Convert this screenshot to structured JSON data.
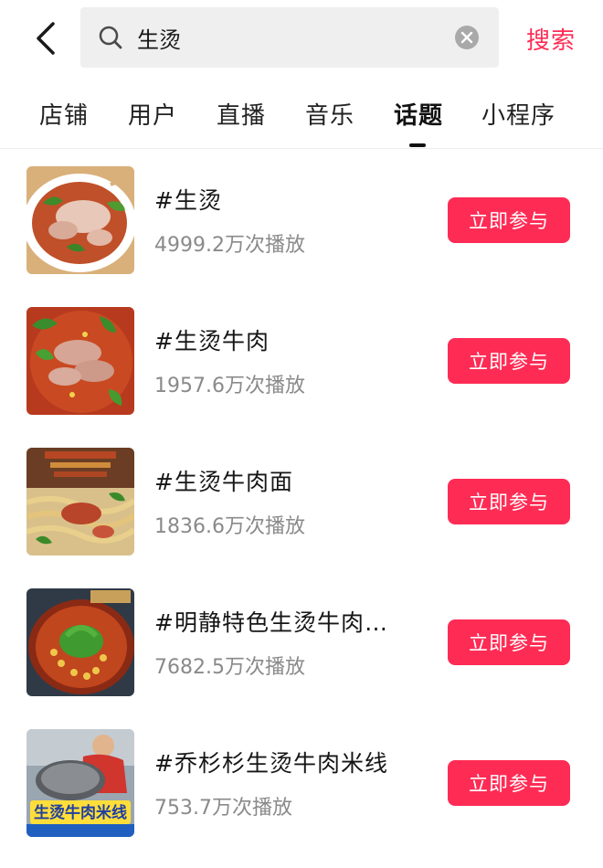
{
  "search": {
    "query": "生烫",
    "button_label": "搜索"
  },
  "tabs": [
    {
      "label": "店铺"
    },
    {
      "label": "用户"
    },
    {
      "label": "直播"
    },
    {
      "label": "音乐"
    },
    {
      "label": "话题",
      "active": true
    },
    {
      "label": "小程序"
    }
  ],
  "topics": [
    {
      "title": "#生烫",
      "plays": "4999.2万次播放",
      "button": "立即参与"
    },
    {
      "title": "#生烫牛肉",
      "plays": "1957.6万次播放",
      "button": "立即参与"
    },
    {
      "title": "#生烫牛肉面",
      "plays": "1836.6万次播放",
      "button": "立即参与"
    },
    {
      "title": "#明静特色生烫牛肉…",
      "plays": "7682.5万次播放",
      "button": "立即参与"
    },
    {
      "title": "#乔杉杉生烫牛肉米线",
      "plays": "753.7万次播放",
      "button": "立即参与"
    }
  ],
  "thumbnail_text": {
    "banner": "生烫牛肉米线"
  },
  "colors": {
    "accent": "#fe2c55",
    "secondary_text": "#8a8a8a",
    "search_bg": "#efefef"
  },
  "icons": [
    "back-arrow-icon",
    "search-icon",
    "clear-icon"
  ]
}
